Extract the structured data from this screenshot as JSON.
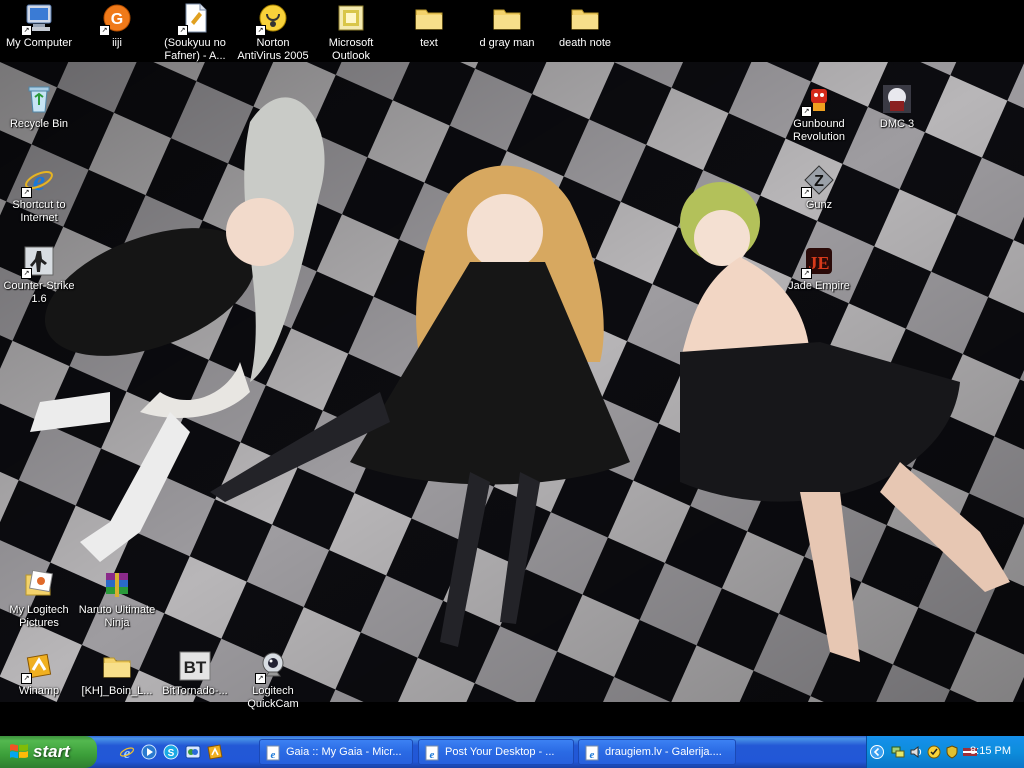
{
  "desktop_icons": [
    {
      "label": "My Computer",
      "icon": "my-computer-icon"
    },
    {
      "label": "iiji",
      "icon": "app-orange-icon"
    },
    {
      "label": "(Soukyuu no Fafner) - A...",
      "icon": "document-icon"
    },
    {
      "label": "Norton AntiVirus 2005",
      "icon": "norton-icon"
    },
    {
      "label": "Microsoft Outlook",
      "icon": "outlook-icon"
    },
    {
      "label": "text",
      "icon": "folder-icon"
    },
    {
      "label": "d gray man",
      "icon": "folder-icon"
    },
    {
      "label": "death note",
      "icon": "folder-icon"
    },
    {
      "label": "Recycle Bin",
      "icon": "recycle-bin-icon"
    },
    {
      "label": "Shortcut to Internet",
      "icon": "internet-explorer-icon"
    },
    {
      "label": "Counter-Strike 1.6",
      "icon": "counter-strike-icon"
    },
    {
      "label": "Gunbound Revolution",
      "icon": "gunbound-icon"
    },
    {
      "label": "DMC 3",
      "icon": "dmc3-icon"
    },
    {
      "label": "Gunz",
      "icon": "gunz-icon"
    },
    {
      "label": "Jade Empire",
      "icon": "jade-empire-icon"
    },
    {
      "label": "My Logitech Pictures",
      "icon": "logitech-pictures-icon"
    },
    {
      "label": "Naruto Ultimate Ninja",
      "icon": "winrar-icon"
    },
    {
      "label": "Winamp",
      "icon": "winamp-icon"
    },
    {
      "label": "[KH]_Boin_L...",
      "icon": "folder-icon"
    },
    {
      "label": "BitTornado-...",
      "icon": "bittornado-icon"
    },
    {
      "label": "Logitech QuickCam",
      "icon": "webcam-icon"
    }
  ],
  "taskbar": {
    "start_label": "start",
    "quick_launch": [
      "internet-explorer-icon",
      "media-player-icon",
      "skype-icon",
      "messenger-icon",
      "winamp-icon"
    ],
    "tasks": [
      {
        "label": "Gaia :: My Gaia - Micr...",
        "icon": "ie-page-icon"
      },
      {
        "label": "Post Your Desktop - ...",
        "icon": "ie-page-icon"
      },
      {
        "label": "draugiem.lv - Galerija....",
        "icon": "ie-page-icon"
      }
    ],
    "tray_icons": [
      "chevron-left-icon",
      "network-icon",
      "speaker-icon",
      "norton-tray-icon",
      "antivirus-tray-icon",
      "latvia-flag-icon"
    ],
    "clock": "8:15 PM"
  },
  "colors": {
    "taskbar": "#2358d6",
    "start_button": "#3b9e39",
    "tray": "#0d8ddc",
    "folder": "#f3d26b"
  }
}
